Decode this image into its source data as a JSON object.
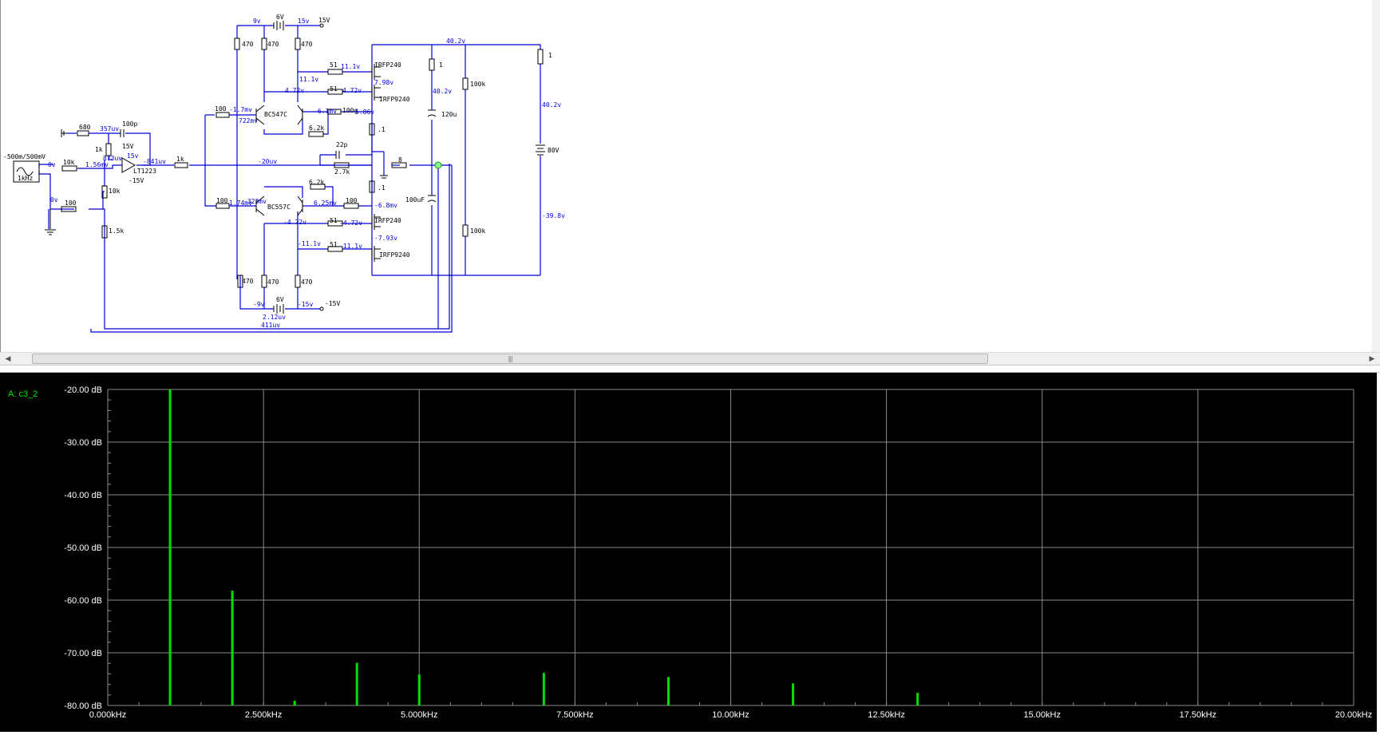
{
  "schematic": {
    "source": {
      "amplitude": "-500m/500mV",
      "freq": "1kHz"
    },
    "components": {
      "r680": "680",
      "c100p": "100p",
      "r1k_a": "1k",
      "r10k_in": "10k",
      "r10k_fb": "10k",
      "r100_in": "100",
      "r1_5k": "1.5k",
      "r1k_out": "1k",
      "opamp": "LT1223",
      "opamp_vp": "15V",
      "opamp_vn": "-15V",
      "r470_1": "470",
      "r470_2": "470",
      "r470_3": "470",
      "r470_4": "470",
      "r470_5": "470",
      "r470_6": "470",
      "bat6v_top": "6V",
      "bat6v_bot": "6V",
      "v15_top": "15V",
      "v15_bot": "-15V",
      "r100_q1": "100",
      "q1": "BC547C",
      "q2": "BC557C",
      "r100_q2": "100",
      "r6_2k_1": "6.2k",
      "r6_2k_2": "6.2k",
      "r100_b": "100g",
      "r100_c": "100",
      "c22p": "22p",
      "r2_7k": "2.7k",
      "r51_1": "51",
      "r51_2": "51",
      "r51_3": "51",
      "r51_4": "51",
      "m1": "IRFP240",
      "m2": "IRFP9240",
      "m3": "IRFP240",
      "m4": "IRFP9240",
      "r0_1_a": ".1",
      "r0_1_b": ".1",
      "r_load": "8",
      "r1_top": "1",
      "c120u": "120u",
      "c100u": "100uF",
      "r100k_a": "100k",
      "r100k_b": "100k",
      "r1_right": "1",
      "bat80": "80V"
    },
    "voltages": {
      "v9": "9v",
      "v15a": "15v",
      "v0": "0v",
      "v357": "357uv",
      "v873": "873uv",
      "v15b": "15v",
      "v156": "1.56mv",
      "v0b": "0v",
      "v841": "-841uv",
      "vm20": "-20uv",
      "vm17": "-1.7mv",
      "v722": "722mv",
      "v111a": "11.1v",
      "v111b": "11.1v",
      "v472a": "4.72v",
      "v472b": "4.72v",
      "v798": "7.98v",
      "vm61": "-6.1mv",
      "v586": "5.86v",
      "v402a": "40.2v",
      "v402b": "40.2v",
      "v402c": "40.2v",
      "v323": "-323mv",
      "v174": "1.74mv",
      "v625": "6.25mv",
      "vm68": "-6.8mv",
      "vm472a": "-4.72v",
      "vm472b": "-4.72v",
      "vm793": "-7.93v",
      "vm111a": "-11.1v",
      "vm111b": "-11.1v",
      "vm398": "-39.8v",
      "vm9": "-9v",
      "vm15": "-15v",
      "v212": "2.12uv",
      "v411": "411uv"
    }
  },
  "chart_data": {
    "type": "bar",
    "title": "",
    "trace_label": "A: c3_2",
    "xlabel": "",
    "ylabel": "",
    "xlim": [
      0,
      20000
    ],
    "ylim": [
      -80,
      -20
    ],
    "x_unit": "kHz",
    "x_ticks": [
      "0.000kHz",
      "2.500kHz",
      "5.000kHz",
      "7.500kHz",
      "10.00kHz",
      "12.50kHz",
      "15.00kHz",
      "17.50kHz",
      "20.00kHz"
    ],
    "y_ticks": [
      "-20.00 dB",
      "-30.00 dB",
      "-40.00 dB",
      "-50.00 dB",
      "-60.00 dB",
      "-70.00 dB",
      "-80.00 dB"
    ],
    "grid": true,
    "color": "#00e000",
    "series": [
      {
        "x": [
          1000,
          2000,
          3000,
          4000,
          5000,
          7000,
          9000,
          11000,
          13000
        ],
        "values": [
          -20.0,
          -58.2,
          -79.1,
          -71.9,
          -74.1,
          -73.8,
          -74.6,
          -75.8,
          -77.6
        ]
      }
    ]
  }
}
